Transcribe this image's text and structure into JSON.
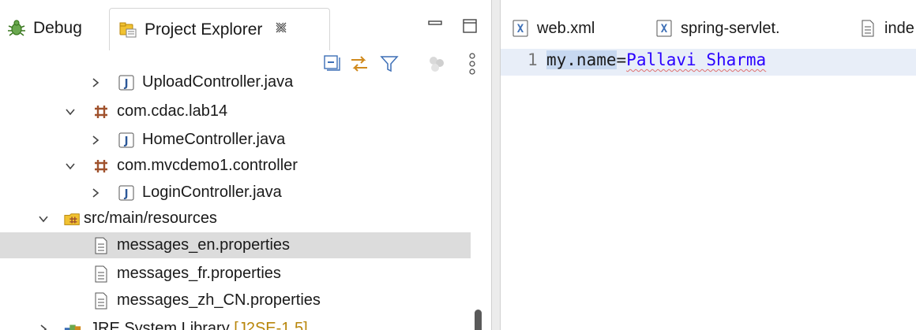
{
  "left_view": {
    "tabs": [
      {
        "label": "Debug",
        "icon": "debug-bug-icon",
        "active": false
      },
      {
        "label": "Project Explorer",
        "icon": "project-explorer-icon",
        "active": true
      }
    ],
    "toolbar": [
      "collapse-all-icon",
      "link-with-editor-icon",
      "filter-icon",
      "focus-icon",
      "view-menu-icon"
    ]
  },
  "tree": {
    "rows": [
      {
        "label": "UploadController.java",
        "type": "java-file",
        "expanded": false,
        "selected": false
      },
      {
        "label": "com.cdac.lab14",
        "type": "package",
        "expanded": true,
        "selected": false
      },
      {
        "label": "HomeController.java",
        "type": "java-file",
        "expanded": false,
        "selected": false
      },
      {
        "label": "com.mvcdemo1.controller",
        "type": "package",
        "expanded": true,
        "selected": false
      },
      {
        "label": "LoginController.java",
        "type": "java-file",
        "expanded": false,
        "selected": false
      },
      {
        "label": "src/main/resources",
        "type": "source-folder",
        "expanded": true,
        "selected": false
      },
      {
        "label": "messages_en.properties",
        "type": "properties-file",
        "selected": true
      },
      {
        "label": "messages_fr.properties",
        "type": "properties-file",
        "selected": false
      },
      {
        "label": "messages_zh_CN.properties",
        "type": "properties-file",
        "selected": false
      },
      {
        "label": "JRE System Library",
        "decoration": "[J2SE-1.5]",
        "type": "library",
        "expanded": false,
        "selected": false
      }
    ]
  },
  "editor": {
    "tabs": [
      {
        "label": "web.xml",
        "icon": "xml-file-icon"
      },
      {
        "label": "spring-servlet.",
        "icon": "xml-file-icon"
      },
      {
        "label": "inde",
        "icon": "text-file-icon"
      }
    ],
    "lines": [
      {
        "number": "1",
        "key": "my.name",
        "separator": "=",
        "value": "Pallavi Sharma"
      }
    ]
  },
  "colors": {
    "selection": "#dcdcdc",
    "current_line": "#e8eef8",
    "value_text": "#2a00ff",
    "package_icon": "#a0522d",
    "java_icon": "#2b5797"
  }
}
